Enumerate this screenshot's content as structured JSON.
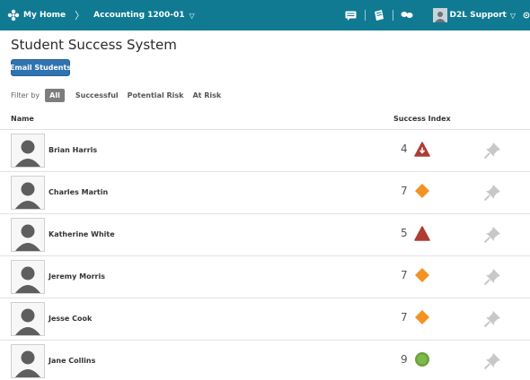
{
  "navbar": {
    "home_label": "My Home",
    "course_label": "Accounting 1200-01",
    "user_label": "D2L Support",
    "chevron": "▽",
    "crumb_separator": "〉"
  },
  "page": {
    "title": "Student Success System",
    "email_button_label": "Email Students"
  },
  "filter": {
    "label": "Filter by",
    "options": [
      {
        "label": "All",
        "active": true
      },
      {
        "label": "Successful",
        "active": false
      },
      {
        "label": "Potential Risk",
        "active": false
      },
      {
        "label": "At Risk",
        "active": false
      }
    ]
  },
  "table": {
    "headers": {
      "name": "Name",
      "success_index": "Success Index"
    },
    "rows": [
      {
        "name": "Brian Harris",
        "score": "4",
        "indicator": "at-risk-triangle-down-arrow"
      },
      {
        "name": "Charles Martin",
        "score": "7",
        "indicator": "potential-risk-diamond"
      },
      {
        "name": "Katherine White",
        "score": "5",
        "indicator": "at-risk-triangle"
      },
      {
        "name": "Jeremy Morris",
        "score": "7",
        "indicator": "potential-risk-diamond"
      },
      {
        "name": "Jesse Cook",
        "score": "7",
        "indicator": "potential-risk-diamond"
      },
      {
        "name": "Jane Collins",
        "score": "9",
        "indicator": "successful-circle"
      }
    ]
  },
  "colors": {
    "navbar": "#107a93",
    "button": "#2f74b0",
    "at_risk": "#b03a34",
    "potential_risk": "#f39223",
    "successful": "#6aa33a"
  }
}
